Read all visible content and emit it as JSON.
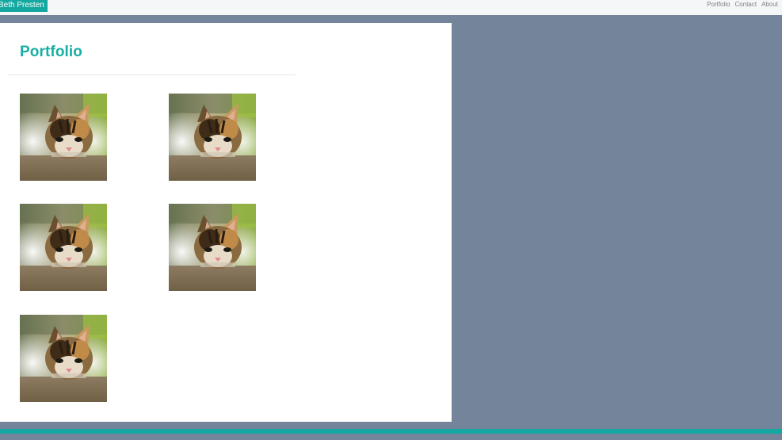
{
  "header": {
    "brand": "Beth Presten",
    "nav": [
      {
        "label": "Portfolio"
      },
      {
        "label": "Contact"
      },
      {
        "label": "About"
      }
    ]
  },
  "main": {
    "title": "Portfolio",
    "thumbnails": [
      {
        "image": "kitten-photo"
      },
      {
        "image": "kitten-photo"
      },
      {
        "image": "kitten-photo"
      },
      {
        "image": "kitten-photo"
      },
      {
        "image": "kitten-photo"
      }
    ]
  },
  "colors": {
    "accent": "#14a8a0",
    "background": "#74859b",
    "panel": "#ffffff",
    "topbar": "#f5f6f8"
  }
}
